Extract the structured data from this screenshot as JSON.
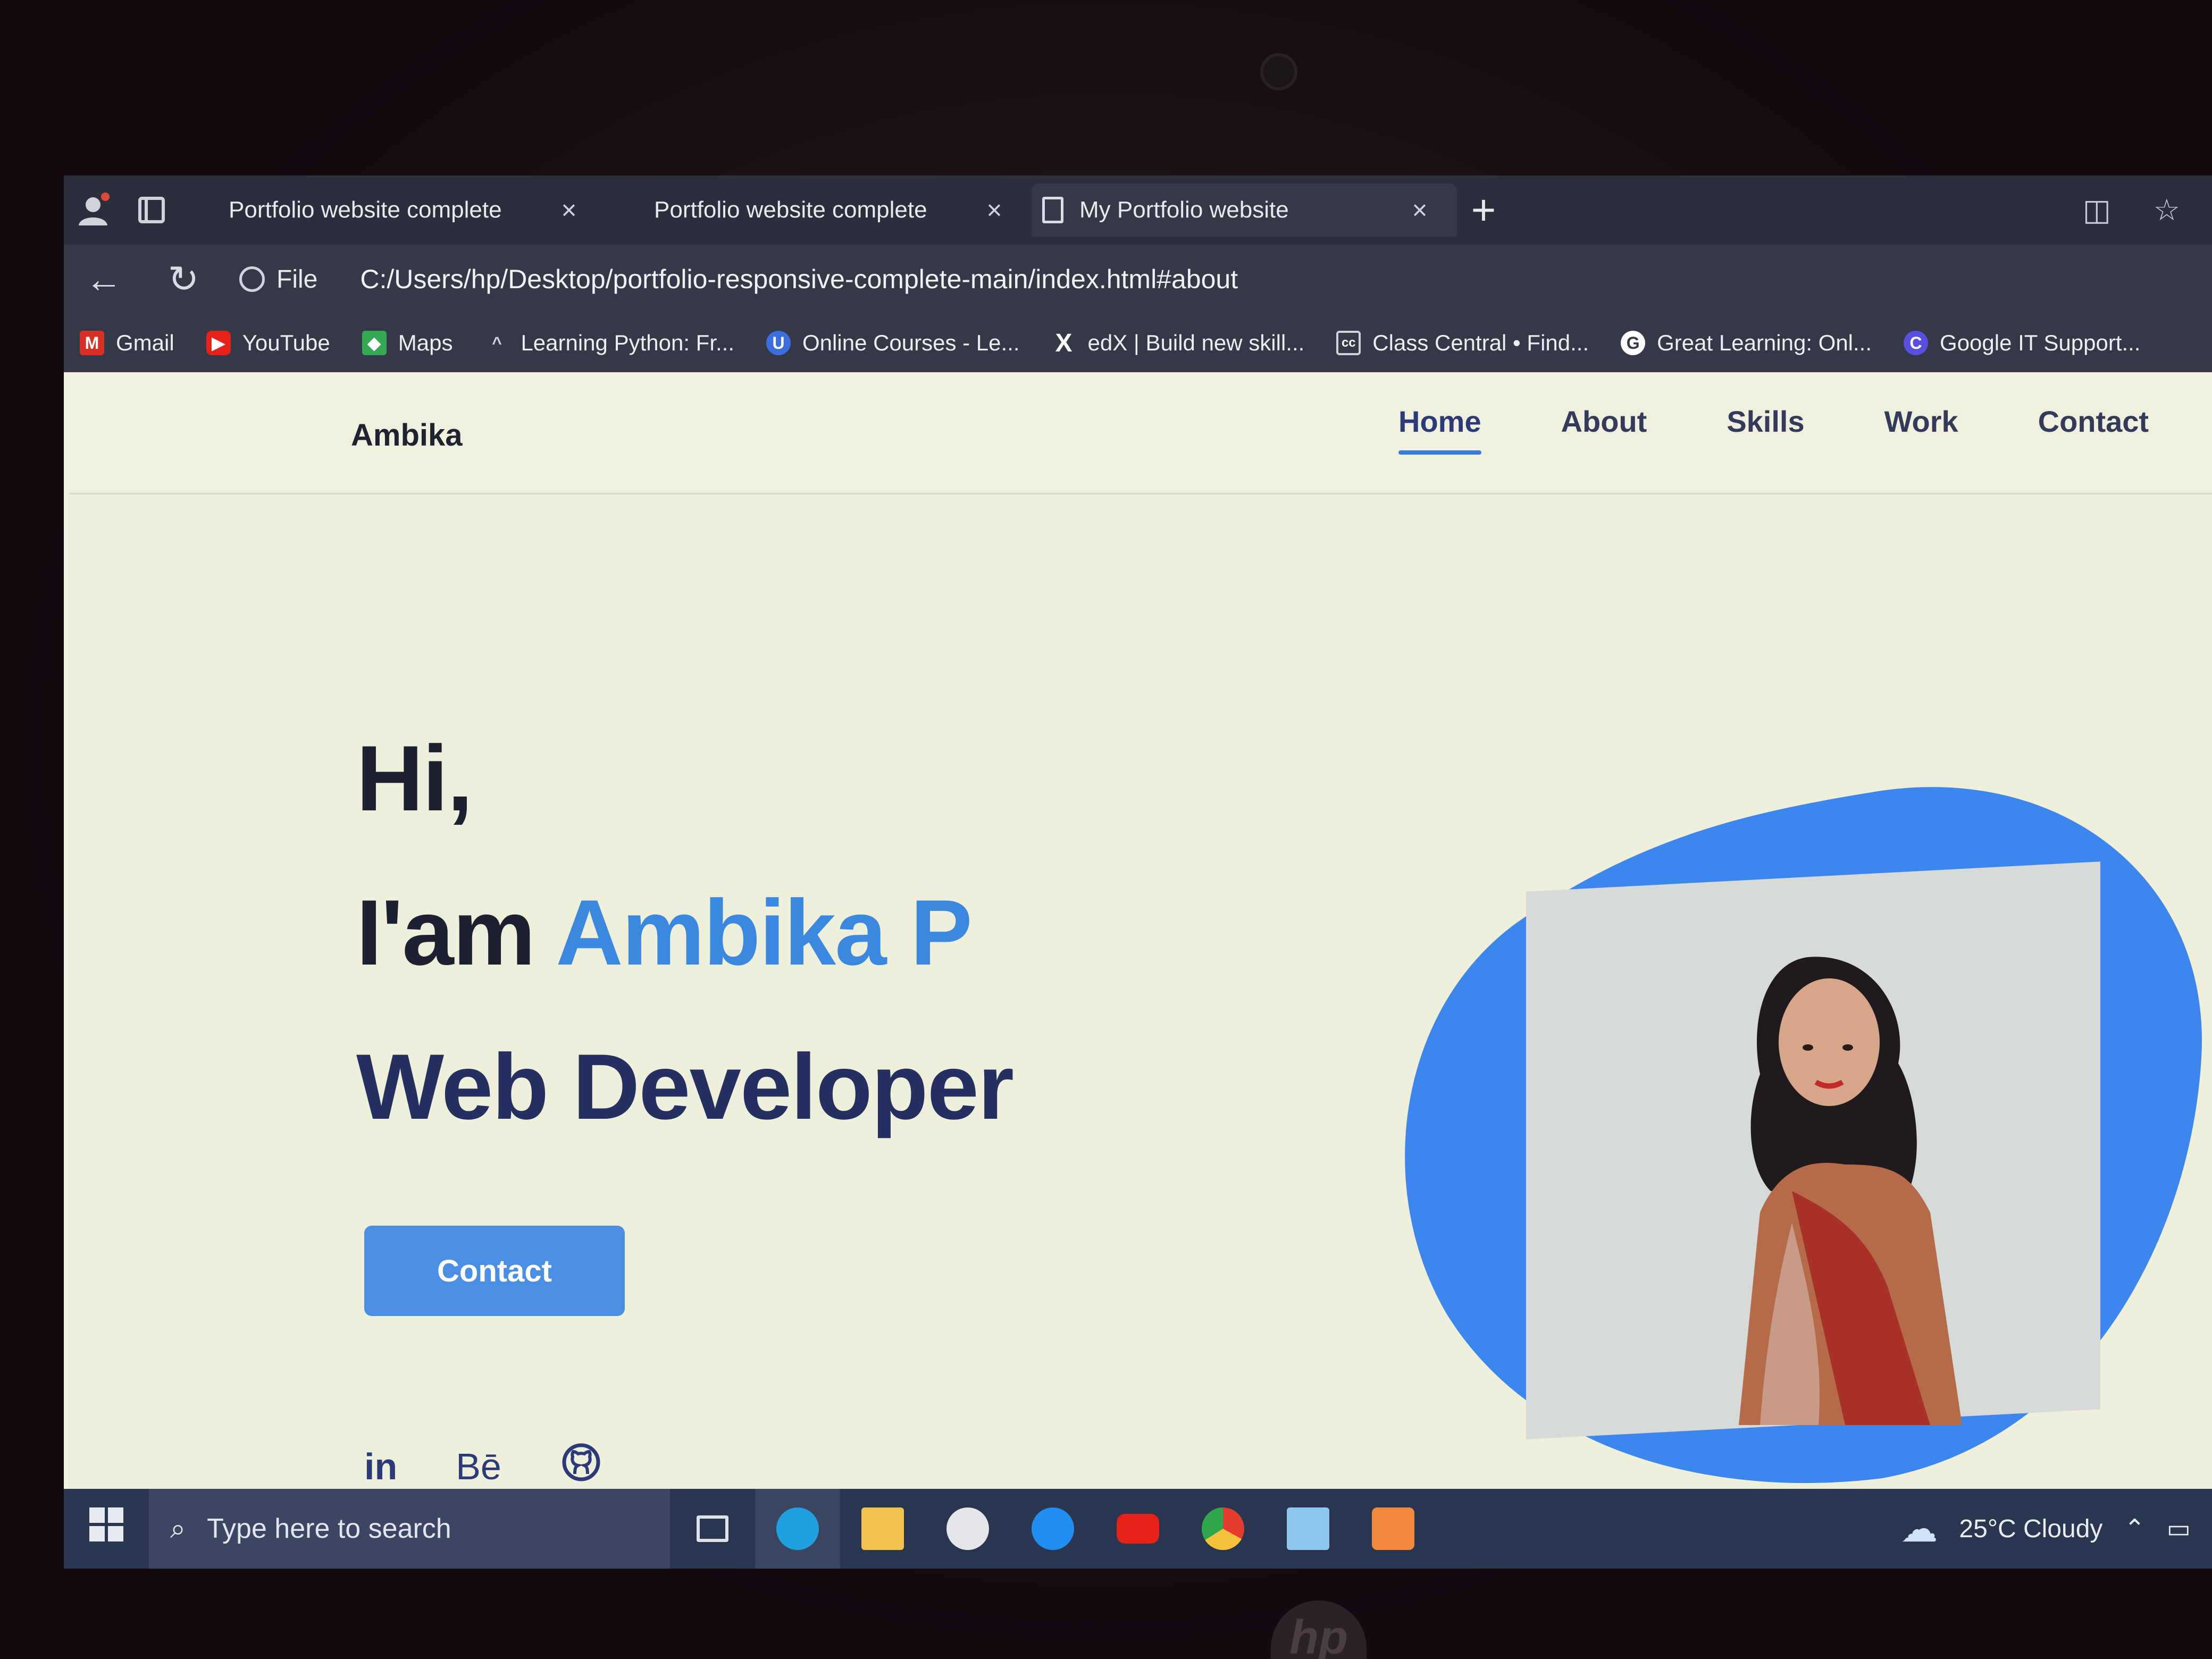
{
  "browser": {
    "tabs": [
      {
        "label": "Portfolio website complete"
      },
      {
        "label": "Portfolio website complete"
      },
      {
        "label": "My Portfolio website"
      }
    ],
    "close_symbol": "×",
    "new_tab_symbol": "+",
    "file_label": "File",
    "url": "C:/Users/hp/Desktop/portfolio-responsive-complete-main/index.html#about",
    "bookmarks": [
      {
        "label": "Gmail",
        "icon": "gmail-icon",
        "color": "#d93025"
      },
      {
        "label": "YouTube",
        "icon": "youtube-icon",
        "color": "#e62117"
      },
      {
        "label": "Maps",
        "icon": "maps-icon",
        "color": "#34a853"
      },
      {
        "label": "Learning Python: Fr...",
        "icon": "bookmark-icon",
        "color": "#7a7f8c"
      },
      {
        "label": "Online Courses - Le...",
        "icon": "udemy-icon",
        "color": "#3b6fe0"
      },
      {
        "label": "edX | Build new skill...",
        "icon": "edx-icon",
        "color": "#343847"
      },
      {
        "label": "Class Central • Find...",
        "icon": "classcentral-icon",
        "color": "#343847"
      },
      {
        "label": "Great Learning: Onl...",
        "icon": "greatlearning-icon",
        "color": "#ffffff"
      },
      {
        "label": "Google IT Support...",
        "icon": "coursera-icon",
        "color": "#5a4fe0"
      }
    ]
  },
  "site": {
    "brand": "Ambika",
    "nav": [
      "Home",
      "About",
      "Skills",
      "Work",
      "Contact"
    ],
    "active_nav": "Home",
    "hero": {
      "line1": "Hi,",
      "line2_prefix": "I'am ",
      "name": "Ambika P",
      "line3": "Web Developer"
    },
    "cta": "Contact",
    "socials": [
      "in",
      "Bē"
    ],
    "accent_color": "#3b88e0"
  },
  "taskbar": {
    "search_placeholder": "Type here to search",
    "weather": "25°C  Cloudy"
  }
}
